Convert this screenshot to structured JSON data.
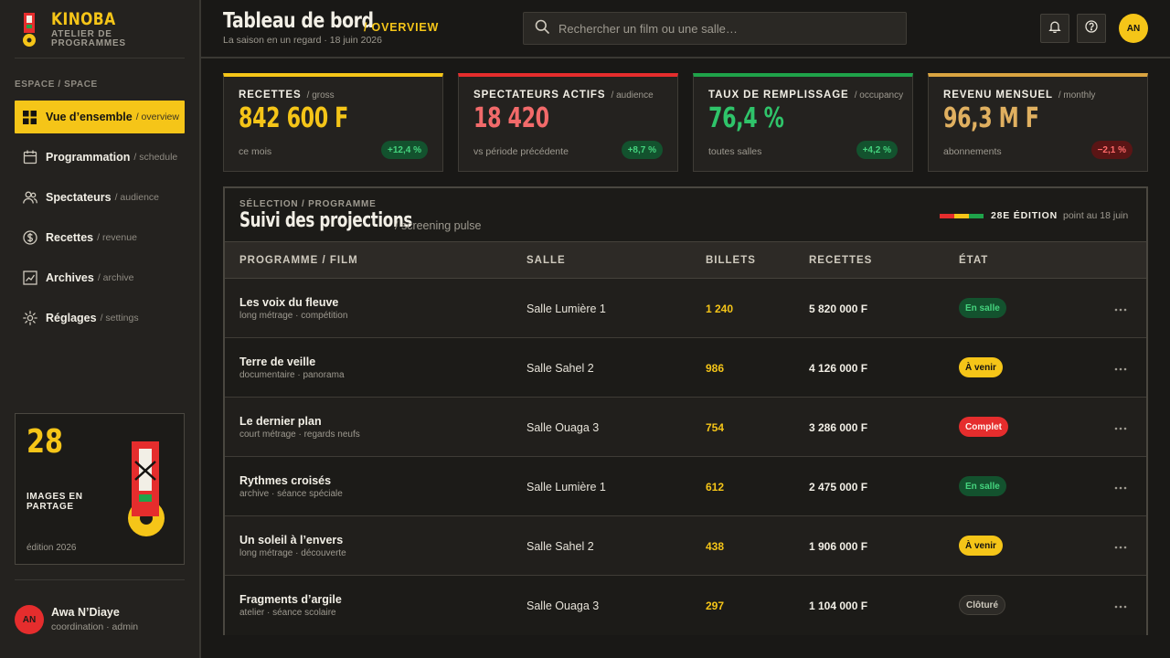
{
  "colors": {
    "accent": "#f5c518",
    "red": "#e52d2d",
    "green": "#1fa34a",
    "gold": "#d9a441"
  },
  "brand": {
    "name": "KINOBA",
    "subtitle": "ATELIER DE PROGRAMMES"
  },
  "sidebar": {
    "section_label": "ESPACE / SPACE",
    "items": [
      {
        "label": "Vue d’ensemble",
        "en": "/ overview",
        "icon": "grid-icon",
        "active": true
      },
      {
        "label": "Programmation",
        "en": "/ schedule",
        "icon": "calendar-icon"
      },
      {
        "label": "Spectateurs",
        "en": "/ audience",
        "icon": "users-icon"
      },
      {
        "label": "Recettes",
        "en": "/ revenue",
        "icon": "dollar-icon"
      },
      {
        "label": "Archives",
        "en": "/ archive",
        "icon": "chart-icon"
      },
      {
        "label": "Réglages",
        "en": "/ settings",
        "icon": "gear-icon"
      }
    ],
    "promo": {
      "number": "28",
      "text": "IMAGES EN PARTAGE",
      "footer": "édition 2026"
    },
    "user": {
      "initials": "AN",
      "name": "Awa N’Diaye",
      "role": "coordination · admin"
    }
  },
  "header": {
    "title": "Tableau de bord",
    "title_en": "/ OVERVIEW",
    "subtitle": "La saison en un regard · 18 juin 2026",
    "search_placeholder": "Rechercher un film ou une salle…",
    "avatar": "AN"
  },
  "kpis": [
    {
      "title": "RECETTES",
      "en": "/ gross",
      "value": "842 600 F",
      "note": "ce mois",
      "delta": "+12,4 %",
      "trend": "up",
      "color": "#f5c518"
    },
    {
      "title": "SPECTATEURS ACTIFS",
      "en": "/ audience",
      "value": "18 420",
      "note": "vs période précédente",
      "delta": "+8,7 %",
      "trend": "up",
      "color": "#f26a6a"
    },
    {
      "title": "TAUX DE REMPLISSAGE",
      "en": "/ occupancy",
      "value": "76,4 %",
      "note": "toutes salles",
      "delta": "+4,2 %",
      "trend": "up",
      "color": "#2fc46a"
    },
    {
      "title": "REVENU MENSUEL",
      "en": "/ monthly",
      "value": "96,3 M F",
      "note": "abonnements",
      "delta": "−2,1 %",
      "trend": "down",
      "color": "#e0b060"
    }
  ],
  "panel": {
    "eyebrow": "SÉLECTION / PROGRAMME",
    "title": "Suivi des projections",
    "title_en": "/ screening pulse",
    "edition": "28E ÉDITION",
    "edition_date": "point au 18 juin",
    "columns": [
      "PROGRAMME / FILM",
      "SALLE",
      "BILLETS",
      "RECETTES",
      "ÉTAT"
    ],
    "rows": [
      {
        "title": "Les voix du fleuve",
        "meta": "long métrage · compétition",
        "hall": "Salle Lumière 1",
        "tickets": "1 240",
        "revenue": "5 820 000 F",
        "status": "En salle",
        "status_type": "green"
      },
      {
        "title": "Terre de veille",
        "meta": "documentaire · panorama",
        "hall": "Salle Sahel 2",
        "tickets": "986",
        "revenue": "4 126 000 F",
        "status": "À venir",
        "status_type": "yellow"
      },
      {
        "title": "Le dernier plan",
        "meta": "court métrage · regards neufs",
        "hall": "Salle Ouaga 3",
        "tickets": "754",
        "revenue": "3 286 000 F",
        "status": "Complet",
        "status_type": "red"
      },
      {
        "title": "Rythmes croisés",
        "meta": "archive · séance spéciale",
        "hall": "Salle Lumière 1",
        "tickets": "612",
        "revenue": "2 475 000 F",
        "status": "En salle",
        "status_type": "green"
      },
      {
        "title": "Un soleil à l’envers",
        "meta": "long métrage · découverte",
        "hall": "Salle Sahel 2",
        "tickets": "438",
        "revenue": "1 906 000 F",
        "status": "À venir",
        "status_type": "yellow"
      },
      {
        "title": "Fragments d’argile",
        "meta": "atelier · séance scolaire",
        "hall": "Salle Ouaga 3",
        "tickets": "297",
        "revenue": "1 104 000 F",
        "status": "Clôturé",
        "status_type": "grey"
      }
    ]
  }
}
